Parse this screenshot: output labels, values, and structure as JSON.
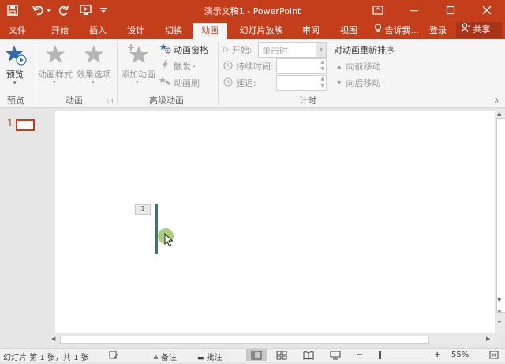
{
  "titlebar": {
    "title": "演示文稿1 - PowerPoint",
    "background": "#c43e1c"
  },
  "tabs": [
    "文件",
    "开始",
    "插入",
    "设计",
    "切换",
    "动画",
    "幻灯片放映",
    "审阅",
    "视图"
  ],
  "active_tab": "动画",
  "tell_me": "告诉我...",
  "login": "登录",
  "share": "共享",
  "ribbon": {
    "preview": {
      "button": "预览",
      "group": "预览"
    },
    "animation": {
      "styles": "动画样式",
      "effects": "效果选项",
      "group": "动画"
    },
    "advanced": {
      "add": "添加动画",
      "pane": "动画窗格",
      "trigger": "触发",
      "painter": "动画刷",
      "group": "高级动画"
    },
    "timing": {
      "start_label": "开始:",
      "start_value": "单击时",
      "duration_label": "持续时间:",
      "delay_label": "延迟:",
      "reorder": "对动画重新排序",
      "move_earlier": "向前移动",
      "move_later": "向后移动",
      "group": "计时"
    }
  },
  "thumbnail": {
    "number": "1"
  },
  "slide": {
    "anim_tag": "1"
  },
  "status": {
    "slide_info": "幻灯片 第 1 张，共 1 张",
    "notes": "备注",
    "comments": "批注",
    "zoom": "55%"
  }
}
